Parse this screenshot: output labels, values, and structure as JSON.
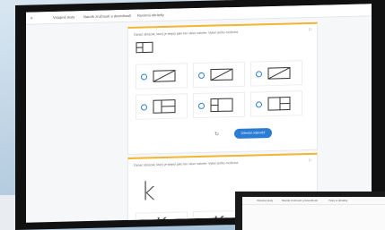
{
  "nav": {
    "logo_text": "",
    "item1": "Vstupné testy ",
    "item2": "Nácvik zručností a dovedností",
    "item3": "Rovinná obrázky"
  },
  "question1": {
    "prompt": "Označ obrázek, který je stejný jako ten vlevo nahoře. Vyber jednu možnost.",
    "reset_label": "↻",
    "submit_label": "Odeslat odpověď"
  },
  "question2": {
    "prompt": "Označ obrázek, který je stejný jako ten vlevo nahoře. Vyber jednu možnost.",
    "sample_glyph": "k",
    "option_glyphs": [
      "K",
      "K"
    ]
  },
  "laptop": {
    "item1": "Vstupné testy ",
    "item2": "Nácvik zručností a dovedností",
    "item3": "Tvary a obrázky"
  },
  "accent_colors": {
    "card_top": "#f3b52f",
    "primary": "#2b7cd3"
  }
}
